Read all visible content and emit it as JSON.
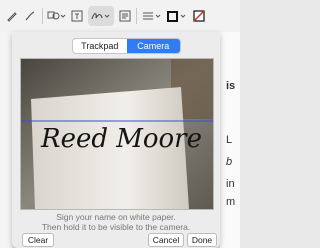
{
  "toolbar": {
    "icons": [
      "sketch-icon",
      "draw-icon",
      "shapes-icon",
      "text-icon",
      "sign-icon",
      "note-icon",
      "line-style-icon",
      "border-color-icon",
      "fill-color-icon"
    ]
  },
  "sheet": {
    "tabs": [
      {
        "label": "Trackpad",
        "active": false
      },
      {
        "label": "Camera",
        "active": true
      }
    ],
    "instructions": {
      "line1": "Sign your name on white paper.",
      "line2": "Then hold it to be visible to the camera."
    },
    "buttons": {
      "clear": "Clear",
      "cancel": "Cancel",
      "done": "Done"
    },
    "signature_text": "Reed Moore"
  },
  "background_doc": {
    "fragments": [
      "is",
      "L",
      "b",
      "in",
      "m"
    ]
  },
  "colors": {
    "accent": "#2f7cf6",
    "guide_line": "#3a4fd1",
    "red_slash": "#d0312d"
  }
}
